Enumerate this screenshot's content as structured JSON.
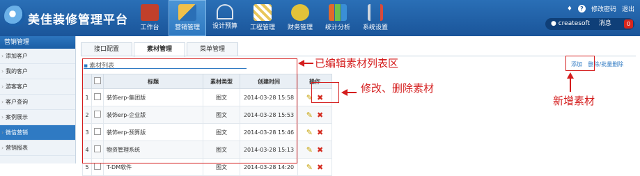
{
  "app": {
    "title": "美佳装修管理平台"
  },
  "nav": [
    {
      "label": "工作台",
      "icon": "book-icon",
      "color": "#c1402b",
      "active": false
    },
    {
      "label": "营销管理",
      "icon": "ruler-icon",
      "color": "#e0a93a",
      "active": true
    },
    {
      "label": "设计预算",
      "icon": "compass-icon",
      "color": "#dbe3ec",
      "active": false
    },
    {
      "label": "工程管理",
      "icon": "barrier-icon",
      "color": "#e8c65a",
      "active": false
    },
    {
      "label": "财务管理",
      "icon": "coins-icon",
      "color": "#e2c23a",
      "active": false
    },
    {
      "label": "统计分析",
      "icon": "bar-chart-icon",
      "color": "#6cc04a",
      "active": false
    },
    {
      "label": "系统设置",
      "icon": "tools-icon",
      "color": "#cfd6de",
      "active": false
    }
  ],
  "topright": {
    "change_password": "修改密码",
    "logout": "退出",
    "username": "createsoft",
    "messages_label": "消息",
    "messages_count": "0"
  },
  "sidebar": {
    "title": "营销管理",
    "items": [
      {
        "label": "添加客户"
      },
      {
        "label": "我的客户"
      },
      {
        "label": "游客客户"
      },
      {
        "label": "客户查询"
      },
      {
        "label": "案例展示"
      },
      {
        "label": "微信营销"
      },
      {
        "label": "营销报表"
      }
    ]
  },
  "tabs": [
    {
      "label": "接口配置"
    },
    {
      "label": "素材管理"
    },
    {
      "label": "菜单管理"
    }
  ],
  "panel": {
    "title": "素材列表",
    "add": "添加",
    "batch_delete": "删除/批量删除"
  },
  "table": {
    "headers": [
      "标题",
      "素材类型",
      "创建时间",
      "操作"
    ],
    "rows": [
      {
        "num": "1",
        "title": "装饰erp-集团版",
        "type": "图文",
        "time": "2014-03-28 15:58"
      },
      {
        "num": "2",
        "title": "装饰erp-企业版",
        "type": "图文",
        "time": "2014-03-28 15:53"
      },
      {
        "num": "3",
        "title": "装饰erp-预算版",
        "type": "图文",
        "time": "2014-03-28 15:46"
      },
      {
        "num": "4",
        "title": "物资管理系统",
        "type": "图文",
        "time": "2014-03-28 15:13"
      },
      {
        "num": "5",
        "title": "T-DM软件",
        "type": "图文",
        "time": "2014-03-28 14:20"
      }
    ]
  },
  "annotations": {
    "list_area": "已编辑素材列表区",
    "edit_delete": "修改、删除素材",
    "add_material": "新增素材"
  }
}
